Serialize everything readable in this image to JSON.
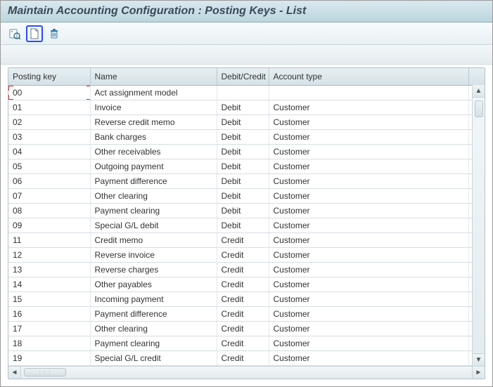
{
  "title": "Maintain Accounting Configuration : Posting Keys - List",
  "toolbar": {
    "details_icon": "details-icon",
    "new_icon": "page-icon",
    "delete_icon": "trash-icon"
  },
  "columns": {
    "key": "Posting key",
    "name": "Name",
    "dc": "Debit/Credit",
    "acct": "Account type"
  },
  "rows": [
    {
      "key": "00",
      "name": "Act assignment model",
      "dc": "",
      "acct": ""
    },
    {
      "key": "01",
      "name": "Invoice",
      "dc": "Debit",
      "acct": "Customer"
    },
    {
      "key": "02",
      "name": "Reverse credit memo",
      "dc": "Debit",
      "acct": "Customer"
    },
    {
      "key": "03",
      "name": "Bank charges",
      "dc": "Debit",
      "acct": "Customer"
    },
    {
      "key": "04",
      "name": "Other receivables",
      "dc": "Debit",
      "acct": "Customer"
    },
    {
      "key": "05",
      "name": "Outgoing payment",
      "dc": "Debit",
      "acct": "Customer"
    },
    {
      "key": "06",
      "name": "Payment difference",
      "dc": "Debit",
      "acct": "Customer"
    },
    {
      "key": "07",
      "name": "Other clearing",
      "dc": "Debit",
      "acct": "Customer"
    },
    {
      "key": "08",
      "name": "Payment clearing",
      "dc": "Debit",
      "acct": "Customer"
    },
    {
      "key": "09",
      "name": "Special G/L debit",
      "dc": "Debit",
      "acct": "Customer"
    },
    {
      "key": "11",
      "name": "Credit memo",
      "dc": "Credit",
      "acct": "Customer"
    },
    {
      "key": "12",
      "name": "Reverse invoice",
      "dc": "Credit",
      "acct": "Customer"
    },
    {
      "key": "13",
      "name": "Reverse charges",
      "dc": "Credit",
      "acct": "Customer"
    },
    {
      "key": "14",
      "name": "Other payables",
      "dc": "Credit",
      "acct": "Customer"
    },
    {
      "key": "15",
      "name": "Incoming payment",
      "dc": "Credit",
      "acct": "Customer"
    },
    {
      "key": "16",
      "name": "Payment difference",
      "dc": "Credit",
      "acct": "Customer"
    },
    {
      "key": "17",
      "name": "Other clearing",
      "dc": "Credit",
      "acct": "Customer"
    },
    {
      "key": "18",
      "name": "Payment clearing",
      "dc": "Credit",
      "acct": "Customer"
    },
    {
      "key": "19",
      "name": "Special G/L credit",
      "dc": "Credit",
      "acct": "Customer"
    }
  ]
}
